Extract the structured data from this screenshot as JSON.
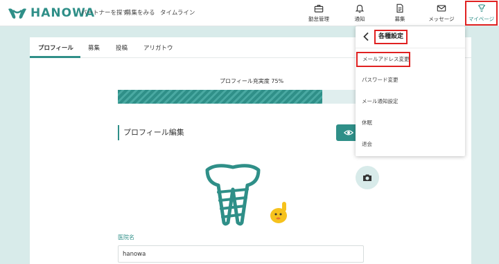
{
  "brand": {
    "name": "HANOWA",
    "color": "#2f8f88"
  },
  "topnav": [
    "パートナーを探す",
    "募集をみる",
    "タイムライン"
  ],
  "iconnav": [
    {
      "label": "勤怠管理",
      "icon": "briefcase-icon"
    },
    {
      "label": "通知",
      "icon": "bell-icon"
    },
    {
      "label": "募集",
      "icon": "document-icon"
    },
    {
      "label": "メッセージ",
      "icon": "mail-icon"
    },
    {
      "label": "マイページ",
      "icon": "tooth-icon",
      "highlighted": true
    }
  ],
  "tabs": [
    "プロフィール",
    "募集",
    "投稿",
    "アリガトウ"
  ],
  "profile": {
    "completion_label": "プロフィール充実度 75%",
    "completion_fraction": 0.75,
    "edit_title": "プロフィール編集",
    "clinic_label": "医院名",
    "clinic_value": "hanowa"
  },
  "dropdown": {
    "title": "各種設定",
    "items": [
      "メールアドレス変更",
      "パスワード変更",
      "メール通知設定",
      "休眠",
      "退会"
    ]
  },
  "colors": {
    "accent": "#2f8f88",
    "highlight": "#e02020",
    "background": "#d8ebea"
  }
}
